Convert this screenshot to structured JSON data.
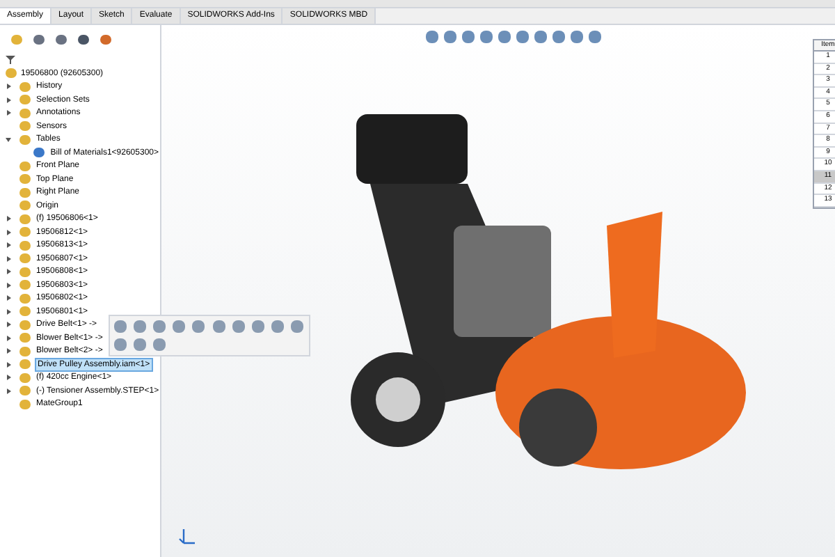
{
  "tabs": [
    {
      "label": "Assembly",
      "selected": true
    },
    {
      "label": "Layout",
      "selected": false
    },
    {
      "label": "Sketch",
      "selected": false
    },
    {
      "label": "Evaluate",
      "selected": false
    },
    {
      "label": "SOLIDWORKS Add-Ins",
      "selected": false
    },
    {
      "label": "SOLIDWORKS MBD",
      "selected": false
    }
  ],
  "tree": {
    "root": "19506800 (92605300)",
    "items": [
      {
        "label": "History",
        "expanded": false
      },
      {
        "label": "Selection Sets",
        "expanded": false
      },
      {
        "label": "Annotations",
        "expanded": false
      },
      {
        "label": "Sensors"
      },
      {
        "label": "Tables",
        "expanded": true,
        "children": [
          {
            "label": "Bill of Materials1<92605300>"
          }
        ]
      },
      {
        "label": "Front Plane"
      },
      {
        "label": "Top Plane"
      },
      {
        "label": "Right Plane"
      },
      {
        "label": "Origin"
      },
      {
        "label": "(f) 19506806<1>",
        "expanded": false
      },
      {
        "label": "19506812<1>",
        "expanded": false
      },
      {
        "label": "19506813<1>",
        "expanded": false
      },
      {
        "label": "19506807<1>",
        "expanded": false
      },
      {
        "label": "19506808<1>",
        "expanded": false
      },
      {
        "label": "19506803<1>",
        "expanded": false
      },
      {
        "label": "19506802<1>",
        "expanded": false
      },
      {
        "label": "19506801<1>",
        "expanded": false
      },
      {
        "label": "Drive Belt<1> ->",
        "expanded": false
      },
      {
        "label": "Blower Belt<1> ->",
        "expanded": false
      },
      {
        "label": "Blower Belt<2> ->",
        "expanded": false
      },
      {
        "label": "Drive Pulley Assembly.iam<1>",
        "expanded": false,
        "selected": true
      },
      {
        "label": "(f) 420cc Engine<1>",
        "expanded": false
      },
      {
        "label": "(-) Tensioner Assembly.STEP<1>",
        "expanded": false
      },
      {
        "label": "MateGroup1"
      }
    ]
  },
  "bom": {
    "header": "Item",
    "rows": [
      {
        "item": "1",
        "selected": false
      },
      {
        "item": "2",
        "selected": false
      },
      {
        "item": "3",
        "selected": false
      },
      {
        "item": "4",
        "selected": false
      },
      {
        "item": "5",
        "selected": false
      },
      {
        "item": "6",
        "selected": false
      },
      {
        "item": "7",
        "selected": false
      },
      {
        "item": "8",
        "selected": false
      },
      {
        "item": "9",
        "selected": false
      },
      {
        "item": "10",
        "selected": false
      },
      {
        "item": "11",
        "selected": true
      },
      {
        "item": "12",
        "selected": false
      },
      {
        "item": "13",
        "selected": false
      }
    ]
  }
}
